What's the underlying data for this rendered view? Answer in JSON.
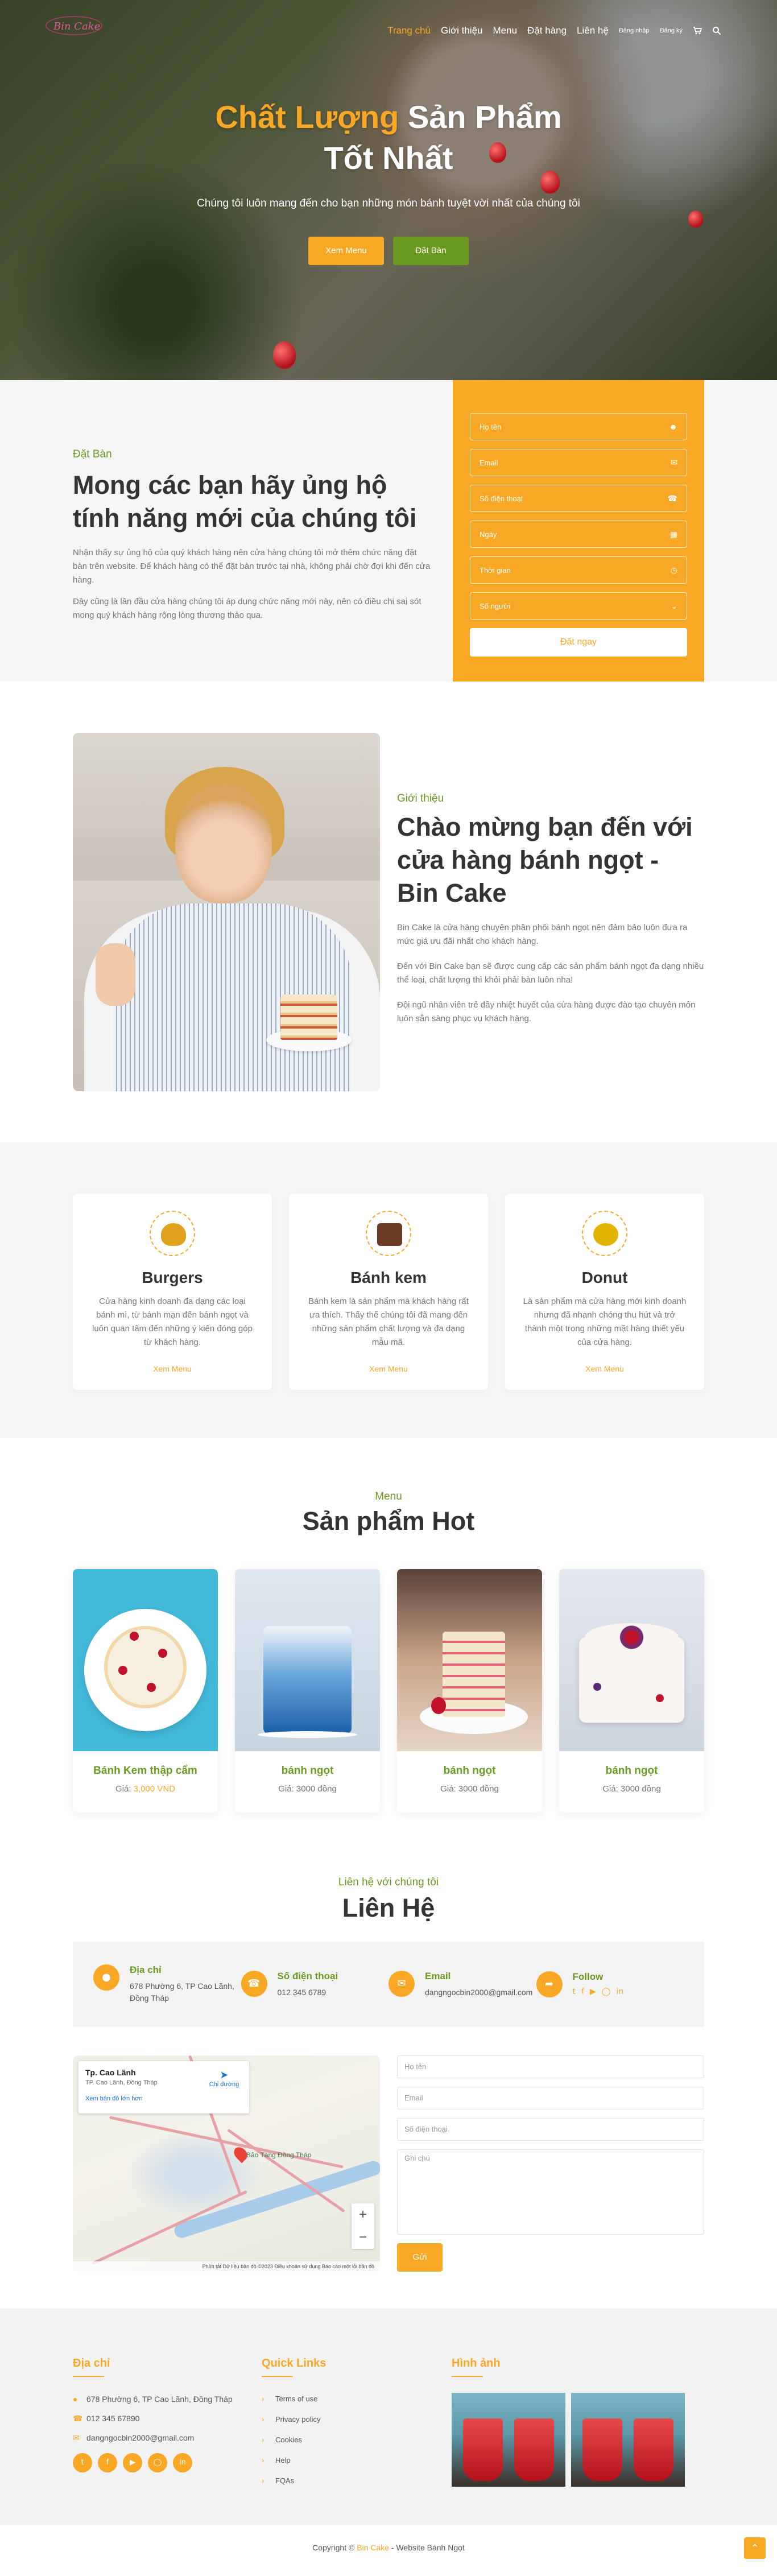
{
  "nav": {
    "items": [
      {
        "label": "Trang chủ",
        "active": true
      },
      {
        "label": "Giới thiệu"
      },
      {
        "label": "Menu"
      },
      {
        "label": "Đặt hàng"
      },
      {
        "label": "Liên hệ"
      },
      {
        "label": "Đăng nhập",
        "small": true
      },
      {
        "label": "Đăng ký",
        "small": true
      }
    ],
    "cart_icon": "cart-icon",
    "search_icon": "search-icon"
  },
  "hero": {
    "title_accent": "Chất Lượng",
    "title_rest": " Sản Phẩm",
    "title_line2": "Tốt Nhất",
    "subtitle": "Chúng tôi luôn mang đến cho bạn những món bánh tuyệt vời nhất của chúng tôi",
    "btn_menu": "Xem Menu",
    "btn_book": "Đặt Bàn"
  },
  "booking": {
    "kicker": "Đặt Bàn",
    "title": "Mong các bạn hãy ủng hộ tính năng mới của chúng tôi",
    "p1": "Nhận thấy sự ủng hộ của quý khách hàng nên cửa hàng chúng tôi mở thêm chức năng đặt bàn trên website. Để khách hàng có thể đặt bàn trước tại nhà, không phải chờ đợi khi đến cửa hàng.",
    "p2": "Đây cũng là lần đầu cửa hàng chúng tôi áp dụng chức năng mới này, nên có điều chi sai sót mong quý khách hàng rộng lòng thương thảo qua.",
    "fields": [
      {
        "placeholder": "Họ tên",
        "icon": "user-icon"
      },
      {
        "placeholder": "Email",
        "icon": "envelope-icon"
      },
      {
        "placeholder": "Số điện thoại",
        "icon": "phone-icon"
      },
      {
        "placeholder": "Ngày",
        "icon": "calendar-icon"
      },
      {
        "placeholder": "Thời gian",
        "icon": "clock-icon"
      },
      {
        "placeholder": "Số người",
        "icon": "chevron-down-icon"
      }
    ],
    "submit": "Đặt ngay"
  },
  "about": {
    "kicker": "Giới thiệu",
    "title": "Chào mừng bạn đến với cửa hàng bánh ngọt - Bin Cake",
    "p1": "Bin Cake là cửa hàng chuyên phân phối bánh ngọt nên đảm bảo luôn đưa ra mức giá ưu đãi nhất cho khách hàng.",
    "p2": "Đến với Bin Cake bạn sẽ được cung cấp các sản phẩm bánh ngọt đa dạng nhiều thể loại, chất lượng thì khỏi phải bàn luôn nha!",
    "p3": "Đội ngũ nhân viên trẻ đầy nhiệt huyết của cửa hàng được đào tạo chuyên môn luôn sẵn sàng phục vụ khách hàng."
  },
  "services": [
    {
      "title": "Burgers",
      "desc": "Cửa hàng kinh doanh đa dạng các loại bánh mì, từ bánh mạn đến bánh ngọt và luôn quan tâm đến những ý kiến đóng góp từ khách hàng.",
      "more": "Xem Menu",
      "color": "#e0a21a"
    },
    {
      "title": "Bánh kem",
      "desc": "Bánh kem là sản phẩm mà khách hàng rất ưa thích. Thấy thế chúng tôi đã mang đến những sản phẩm chất lượng và đa dạng mẫu mã.",
      "more": "Xem Menu",
      "color": "#6b3b26"
    },
    {
      "title": "Donut",
      "desc": "Là sản phẩm mà cửa hàng mới kinh doanh nhưng đã nhanh chóng thu hút và trở thành một trong những mặt hàng thiết yếu của cửa hàng.",
      "more": "Xem Menu",
      "color": "#e0b400"
    }
  ],
  "products": {
    "kicker": "Menu",
    "title": "Sản phẩm Hot",
    "items": [
      {
        "name": "Bánh Kem thập cẩm",
        "price_label": "Giá:",
        "price": "3,000 VND",
        "highlight": true,
        "name_color": "#6a9a1f"
      },
      {
        "name": "bánh ngọt",
        "price_label": "Giá:",
        "price": "3000 đồng"
      },
      {
        "name": "bánh ngọt",
        "price_label": "Giá:",
        "price": "3000 đồng"
      },
      {
        "name": "bánh ngọt",
        "price_label": "Giá:",
        "price": "3000 đồng"
      }
    ]
  },
  "contact": {
    "kicker": "Liên hệ với chúng tôi",
    "title": "Liên Hệ",
    "info": [
      {
        "title": "Địa chỉ",
        "value": "678 Phường 6, TP Cao Lãnh, Đồng Tháp",
        "icon": "map-pin-icon"
      },
      {
        "title": "Số điện thoại",
        "value": "012 345 6789",
        "icon": "phone-icon"
      },
      {
        "title": "Email",
        "value": "dangngocbin2000@gmail.com",
        "icon": "envelope-icon"
      },
      {
        "title": "Follow",
        "value": "",
        "icon": "share-icon"
      }
    ],
    "map": {
      "place": "Tp. Cao Lãnh",
      "address": "TP. Cao Lãnh, Đồng Tháp",
      "link": "Xem bản đồ lớn hơn",
      "directions": "Chỉ đường",
      "label": "Bảo Tàng Đồng Tháp",
      "footer": "Phím tắt   Dữ liệu bản đồ ©2023   Điều khoản sử dụng   Báo cáo một lỗi bản đồ"
    },
    "form": {
      "name": "Họ tên",
      "email": "Email",
      "phone": "Số điện thoại",
      "note": "Ghi chú",
      "send": "Gửi"
    }
  },
  "footer": {
    "col1_title": "Địa chỉ",
    "address": "678 Phường 6, TP Cao Lãnh, Đồng Tháp",
    "phone": "012 345 67890",
    "email": "dangngocbin2000@gmail.com",
    "col2_title": "Quick Links",
    "links": [
      "Terms of use",
      "Privacy policy",
      "Cookies",
      "Help",
      "FQAs"
    ],
    "col3_title": "Hình ảnh"
  },
  "copyright": {
    "prefix": "Copyright © ",
    "brand": "Bin Cake",
    "suffix": " - Website Bánh Ngọt"
  }
}
